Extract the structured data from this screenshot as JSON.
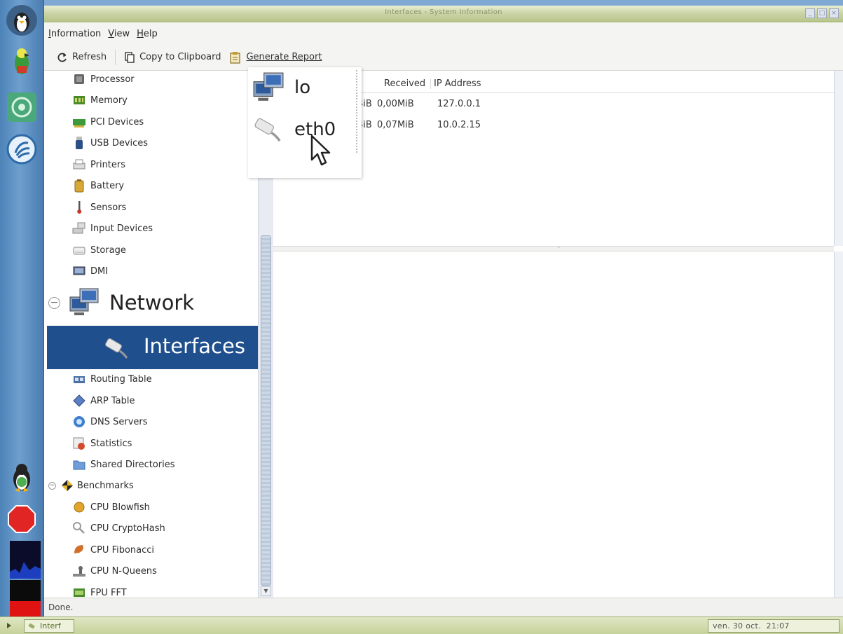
{
  "window": {
    "title": "Interfaces - System Information"
  },
  "menubar": {
    "items": [
      "Information",
      "View",
      "Help"
    ]
  },
  "toolbar": {
    "refresh_label": "Refresh",
    "copy_label": "Copy to Clipboard",
    "report_label": "Generate Report"
  },
  "tree": {
    "items": [
      {
        "label": "Processor",
        "icon": "processor-icon"
      },
      {
        "label": "Memory",
        "icon": "memory-icon"
      },
      {
        "label": "PCI Devices",
        "icon": "pci-icon"
      },
      {
        "label": "USB Devices",
        "icon": "usb-icon"
      },
      {
        "label": "Printers",
        "icon": "printer-icon"
      },
      {
        "label": "Battery",
        "icon": "battery-icon"
      },
      {
        "label": "Sensors",
        "icon": "thermometer-icon"
      },
      {
        "label": "Input Devices",
        "icon": "input-devices-icon"
      },
      {
        "label": "Storage",
        "icon": "storage-icon"
      },
      {
        "label": "DMI",
        "icon": "dmi-icon"
      }
    ],
    "network_label": "Network",
    "selected_label": "Interfaces",
    "network_items": [
      {
        "label": "Routing Table",
        "icon": "routing-icon"
      },
      {
        "label": "ARP Table",
        "icon": "arp-icon"
      },
      {
        "label": "DNS Servers",
        "icon": "dns-icon"
      },
      {
        "label": "Statistics",
        "icon": "statistics-icon"
      },
      {
        "label": "Shared Directories",
        "icon": "shared-folder-icon"
      }
    ],
    "benchmarks_label": "Benchmarks",
    "benchmark_items": [
      {
        "label": "CPU Blowfish",
        "icon": "blowfish-icon"
      },
      {
        "label": "CPU CryptoHash",
        "icon": "cryptohash-icon"
      },
      {
        "label": "CPU Fibonacci",
        "icon": "fibonacci-icon"
      },
      {
        "label": "CPU N-Queens",
        "icon": "nqueens-icon"
      },
      {
        "label": "FPU FFT",
        "icon": "fft-icon"
      }
    ]
  },
  "list": {
    "headers": {
      "received": "Received",
      "ip": "IP Address"
    },
    "rows": [
      {
        "sent_tail": "4iB",
        "received": "0,00MiB",
        "ip": "127.0.0.1"
      },
      {
        "sent_tail": "4iB",
        "received": "0,07MiB",
        "ip": "10.0.2.15"
      }
    ]
  },
  "zoom": {
    "items": [
      {
        "label": "lo",
        "icon": "network-computer-icon"
      },
      {
        "label": "eth0",
        "icon": "ethernet-cable-icon"
      }
    ]
  },
  "status": {
    "text": "Done."
  },
  "taskbar": {
    "task_label": "Interf",
    "clock": "ven. 30 oct.  21:07"
  },
  "colors": {
    "selection": "#1f4f8c",
    "dock": "#5f93c5",
    "titlebar": "#c9d3a4"
  }
}
